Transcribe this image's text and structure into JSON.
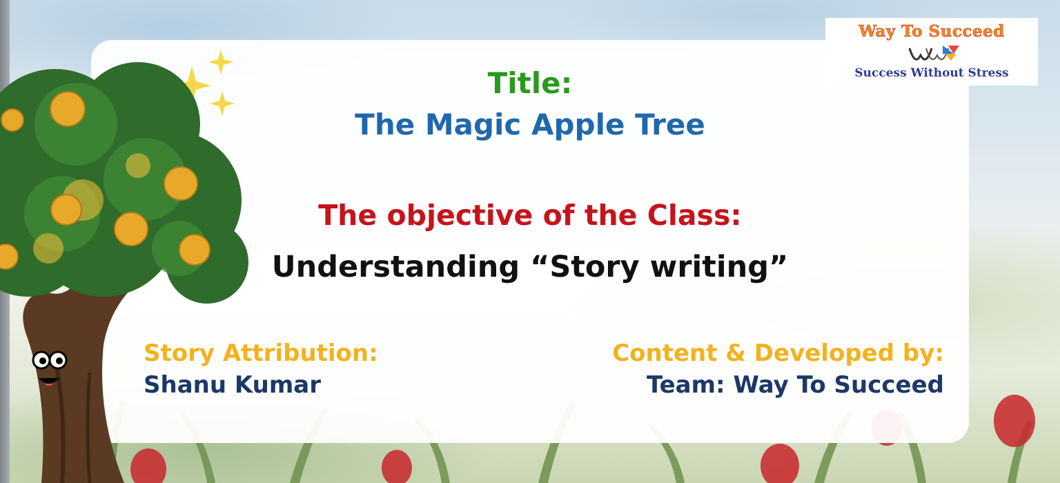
{
  "slide": {
    "title_label": "Title:",
    "story_title": "The Magic Apple Tree",
    "objective_label": "The objective of the Class:",
    "objective_text": "Understanding “Story writing”",
    "attribution_label": "Story Attribution:",
    "attribution_name": "Shanu Kumar",
    "credit_label": "Content & Developed by:",
    "credit_name": "Team: Way To Succeed"
  },
  "logo": {
    "name": "Way To Succeed",
    "tagline": "Success Without Stress"
  },
  "colors": {
    "title_label": "#2a9a1c",
    "story_title": "#1f68ae",
    "objective_label": "#c5141c",
    "attribution_label": "#f2b21f",
    "names": "#1c3866"
  },
  "icons": [
    "apple-tree-icon",
    "sparkles-icon",
    "tulip-icon",
    "logo-mark-icon"
  ]
}
